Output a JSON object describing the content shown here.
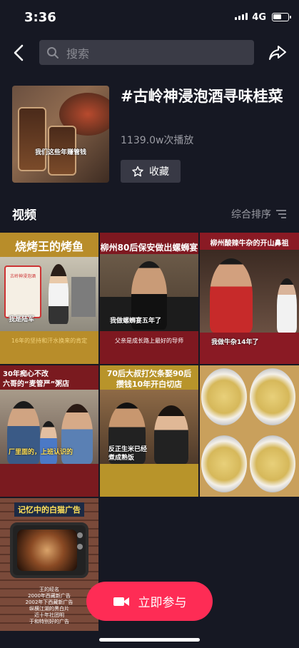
{
  "status_bar": {
    "time": "3:36",
    "network": "4G"
  },
  "search": {
    "placeholder": "搜索"
  },
  "topic": {
    "title": "#古岭神浸泡酒寻味桂菜",
    "play_count": "1139.0w次播放",
    "cover_caption": "我们这些年赚管钱",
    "favorite_label": "收藏"
  },
  "section": {
    "label": "视频",
    "sort_label": "综合排序"
  },
  "videos": [
    {
      "header": "烧烤王的烤鱼",
      "caption": "我是陆军",
      "subtitle": "16年的坚持和汗水换来的肯定",
      "jar_label": "古岭神浸泡酒"
    },
    {
      "header": "柳州80后保安做出螺蛳宴",
      "caption": "我做螺蛳宴五年了",
      "subtitle": "父亲是成长路上最好的导师"
    },
    {
      "header": "柳州酸辣牛杂的开山鼻祖",
      "caption": "我做牛杂14年了"
    },
    {
      "header": "30年痴心不改\n六哥的“麦管严”粥店",
      "caption": "厂里面的，上班认识的"
    },
    {
      "header": "70后大叔打欠条娶90后\n攒钱10年开白切店",
      "caption": "反正生米已经\n煮成熟饭"
    },
    {
      "header": ""
    },
    {
      "header": "记忆中的白猫广告",
      "subtitle": "王的经名\n2000年西藏新广告\n2002年下西藏新广告\n纵横江湖的黑白片\n近十年社团明\n于和特别好的广告"
    }
  ],
  "join_button": {
    "label": "立即参与"
  },
  "colors": {
    "accent": "#fe2c55",
    "background": "#161823"
  }
}
